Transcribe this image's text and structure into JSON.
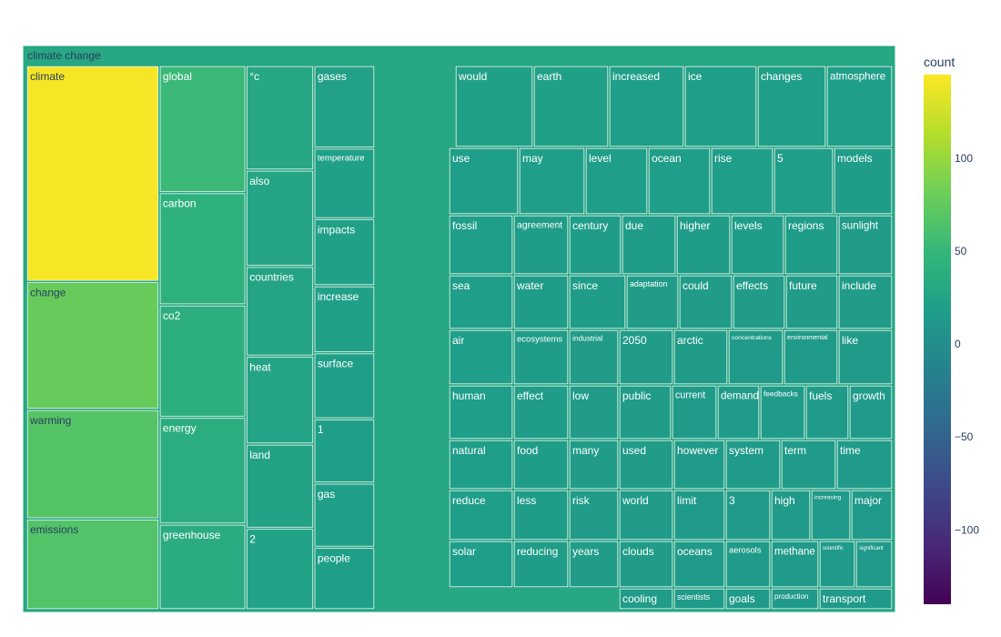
{
  "chart_data": {
    "type": "treemap",
    "root": {
      "label": "climate change",
      "value": 30
    },
    "colorbar": {
      "title": "count",
      "range": [
        -140,
        145
      ],
      "ticks": [
        100,
        50,
        0,
        -50,
        -100
      ],
      "tick_labels": [
        "100",
        "50",
        "0",
        "−50",
        "−100"
      ],
      "colorscale": [
        "#440154",
        "#482878",
        "#3e4989",
        "#31688e",
        "#26828e",
        "#1f9e89",
        "#35b779",
        "#6ece58",
        "#b5de2b",
        "#fde725"
      ]
    },
    "columns": [
      {
        "weight": 176,
        "items": [
          {
            "label": "climate",
            "value": 142,
            "weight": 233
          },
          {
            "label": "change",
            "value": 78,
            "weight": 138
          },
          {
            "label": "warming",
            "value": 68,
            "weight": 118
          },
          {
            "label": "emissions",
            "value": 66,
            "weight": 98
          }
        ]
      },
      {
        "weight": 115,
        "items": [
          {
            "label": "global",
            "value": 52,
            "weight": 138
          },
          {
            "label": "carbon",
            "value": 42,
            "weight": 122
          },
          {
            "label": "co2",
            "value": 38,
            "weight": 122
          },
          {
            "label": "energy",
            "value": 37,
            "weight": 116
          },
          {
            "label": "greenhouse",
            "value": 35,
            "weight": 93
          }
        ]
      },
      {
        "weight": 90,
        "items": [
          {
            "label": "°c",
            "value": 30,
            "weight": 113
          },
          {
            "label": "also",
            "value": 27,
            "weight": 104
          },
          {
            "label": "countries",
            "value": 26,
            "weight": 97
          },
          {
            "label": "heat",
            "value": 25,
            "weight": 95
          },
          {
            "label": "land",
            "value": 24,
            "weight": 91
          },
          {
            "label": "2",
            "value": 23,
            "weight": 88
          }
        ]
      },
      {
        "weight": 81,
        "items": [
          {
            "label": "gases",
            "value": 22,
            "weight": 90
          },
          {
            "label": "temperature",
            "value": 21,
            "weight": 77
          },
          {
            "label": "impacts",
            "value": 21,
            "weight": 73
          },
          {
            "label": "increase",
            "value": 21,
            "weight": 73
          },
          {
            "label": "surface",
            "value": 20,
            "weight": 72
          },
          {
            "label": "1",
            "value": 20,
            "weight": 70
          },
          {
            "label": "gas",
            "value": 20,
            "weight": 70
          },
          {
            "label": "people",
            "value": 20,
            "weight": 68
          }
        ]
      }
    ],
    "right_block": [
      {
        "label": "would",
        "value": 21
      },
      {
        "label": "earth",
        "value": 21
      },
      {
        "label": "increased",
        "value": 20
      },
      {
        "label": "ice",
        "value": 20
      },
      {
        "label": "changes",
        "value": 20
      },
      {
        "label": "atmosphere",
        "value": 19
      },
      {
        "label": "use",
        "value": 19
      },
      {
        "label": "may",
        "value": 19
      },
      {
        "label": "level",
        "value": 18
      },
      {
        "label": "ocean",
        "value": 18
      },
      {
        "label": "rise",
        "value": 18
      },
      {
        "label": "5",
        "value": 18
      },
      {
        "label": "models",
        "value": 17
      },
      {
        "label": "fossil",
        "value": 18
      },
      {
        "label": "agreement",
        "value": 17
      },
      {
        "label": "century",
        "value": 17
      },
      {
        "label": "due",
        "value": 17
      },
      {
        "label": "higher",
        "value": 17
      },
      {
        "label": "levels",
        "value": 17
      },
      {
        "label": "regions",
        "value": 17
      },
      {
        "label": "sunlight",
        "value": 16
      },
      {
        "label": "sea",
        "value": 18
      },
      {
        "label": "water",
        "value": 17
      },
      {
        "label": "since",
        "value": 17
      },
      {
        "label": "adaptation",
        "value": 16
      },
      {
        "label": "could",
        "value": 16
      },
      {
        "label": "effects",
        "value": 16
      },
      {
        "label": "future",
        "value": 16
      },
      {
        "label": "include",
        "value": 16
      },
      {
        "label": "air",
        "value": 18
      },
      {
        "label": "ecosystems",
        "value": 17
      },
      {
        "label": "industrial",
        "value": 16
      },
      {
        "label": "2050",
        "value": 16
      },
      {
        "label": "arctic",
        "value": 16
      },
      {
        "label": "concentrations",
        "value": 15
      },
      {
        "label": "environmental",
        "value": 15
      },
      {
        "label": "like",
        "value": 15
      },
      {
        "label": "human",
        "value": 18
      },
      {
        "label": "effect",
        "value": 17
      },
      {
        "label": "low",
        "value": 16
      },
      {
        "label": "public",
        "value": 16
      },
      {
        "label": "current",
        "value": 15
      },
      {
        "label": "demand",
        "value": 15
      },
      {
        "label": "feedbacks",
        "value": 15
      },
      {
        "label": "fuels",
        "value": 15
      },
      {
        "label": "growth",
        "value": 15
      },
      {
        "label": "natural",
        "value": 18
      },
      {
        "label": "food",
        "value": 17
      },
      {
        "label": "many",
        "value": 16
      },
      {
        "label": "used",
        "value": 16
      },
      {
        "label": "however",
        "value": 15
      },
      {
        "label": "system",
        "value": 15
      },
      {
        "label": "term",
        "value": 15
      },
      {
        "label": "time",
        "value": 15
      },
      {
        "label": "reduce",
        "value": 18
      },
      {
        "label": "less",
        "value": 17
      },
      {
        "label": "risk",
        "value": 16
      },
      {
        "label": "world",
        "value": 16
      },
      {
        "label": "limit",
        "value": 15
      },
      {
        "label": "3",
        "value": 15
      },
      {
        "label": "high",
        "value": 15
      },
      {
        "label": "increasing",
        "value": 14
      },
      {
        "label": "major",
        "value": 14
      },
      {
        "label": "solar",
        "value": 18
      },
      {
        "label": "reducing",
        "value": 17
      },
      {
        "label": "years",
        "value": 16
      },
      {
        "label": "clouds",
        "value": 16
      },
      {
        "label": "oceans",
        "value": 15
      },
      {
        "label": "aerosols",
        "value": 15
      },
      {
        "label": "methane",
        "value": 14
      },
      {
        "label": "scientific",
        "value": 14
      },
      {
        "label": "significant",
        "value": 14
      },
      {
        "label": "cooling",
        "value": 16
      },
      {
        "label": "scientists",
        "value": 15
      },
      {
        "label": "goals",
        "value": 15
      },
      {
        "label": "production",
        "value": 14
      },
      {
        "label": "transport",
        "value": 14
      }
    ]
  }
}
